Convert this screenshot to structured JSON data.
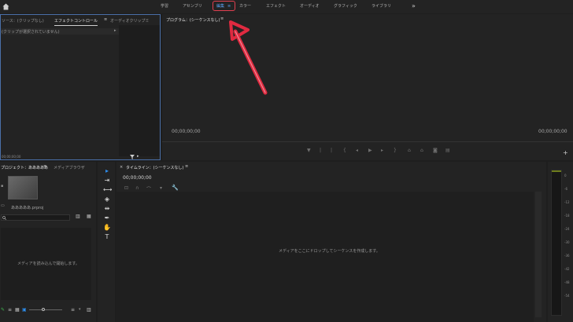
{
  "workspaces": [
    "学習",
    "アセンブリ",
    "編集",
    "カラー",
    "エフェクト",
    "オーディオ",
    "グラフィック",
    "ライブラリ"
  ],
  "active_workspace": "編集",
  "more_glyph": "»",
  "source_panel": {
    "tabs": [
      "ソース：(クリップなし)",
      "エフェクトコントロール",
      "オーディオクリップミ"
    ],
    "message": "(クリップが選択されていません)",
    "timecode": "00;00;00;00"
  },
  "program_panel": {
    "title": "プログラム：(シーケンスなし)",
    "menu_glyph": "≡",
    "timecode_left": "00;00;00;00",
    "timecode_right": "00;00;00;00",
    "add_glyph": "+"
  },
  "project_panel": {
    "tabs": [
      "プロジェクト：あああああ",
      "メディアブラウザ"
    ],
    "menu_glyph": "≡",
    "clip_name": "あああああ.prproj",
    "search_placeholder": "",
    "empty_message": "メディアを読み込んで開始します。"
  },
  "timeline_panel": {
    "close_glyph": "×",
    "title": "タイムライン：(シーケンスなし)",
    "menu_glyph": "≡",
    "timecode": "00;00;00;00",
    "empty_message": "メディアをここにドロップしてシーケンスを作成します。"
  },
  "meter_labels": [
    "0",
    "-6",
    "-12",
    "-18",
    "-24",
    "-30",
    "-36",
    "-42",
    "-48",
    "-54"
  ],
  "colors": {
    "accent": "#2d8ceb",
    "highlight_box": "#e04050",
    "arrow": "#e02a40"
  }
}
